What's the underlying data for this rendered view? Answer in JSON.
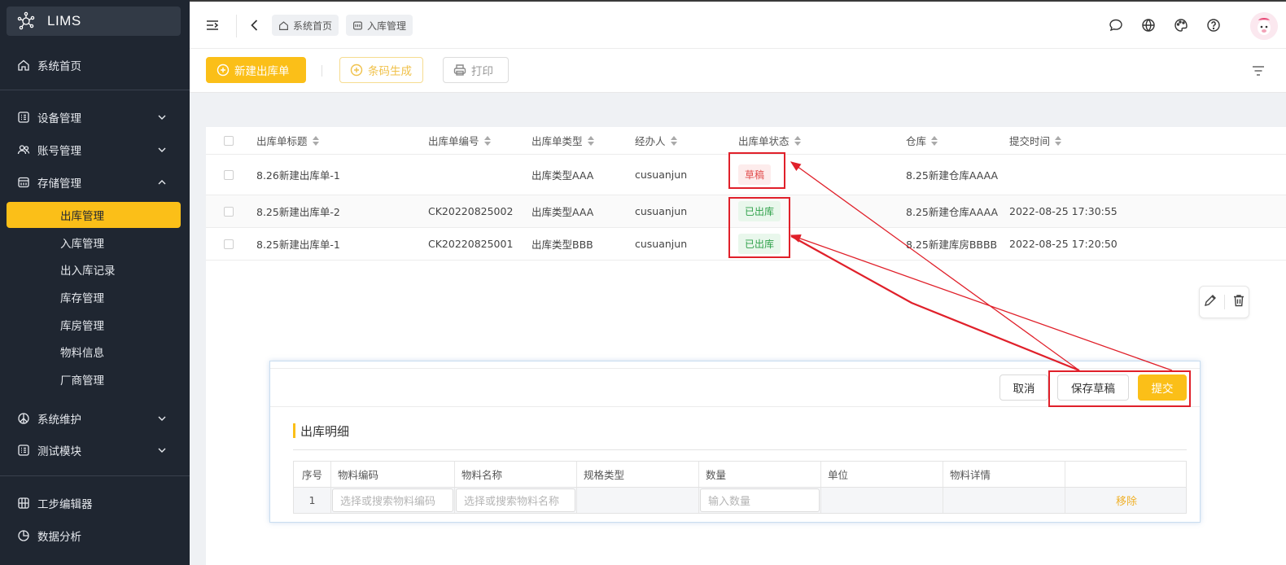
{
  "app": {
    "name": "LIMS"
  },
  "sidebar": {
    "items": [
      {
        "label": "系统首页",
        "icon": "home-icon"
      },
      {
        "label": "设备管理",
        "icon": "list-box-icon"
      },
      {
        "label": "账号管理",
        "icon": "users-icon"
      },
      {
        "label": "存储管理",
        "icon": "storage-icon"
      },
      {
        "label": "出库管理",
        "active": true
      },
      {
        "label": "入库管理"
      },
      {
        "label": "出入库记录"
      },
      {
        "label": "库存管理"
      },
      {
        "label": "库房管理"
      },
      {
        "label": "物料信息"
      },
      {
        "label": "厂商管理"
      },
      {
        "label": "系统维护",
        "icon": "peace-icon"
      },
      {
        "label": "测试模块",
        "icon": "list-box-icon"
      },
      {
        "label": "工步编辑器",
        "icon": "grid-icon"
      },
      {
        "label": "数据分析",
        "icon": "pie-chart-icon"
      }
    ]
  },
  "topbar": {
    "breadcrumbs": [
      {
        "label": "系统首页"
      },
      {
        "label": "入库管理"
      }
    ]
  },
  "toolbar": {
    "new_label": "新建出库单",
    "barcode_label": "条码生成",
    "print_label": "打印"
  },
  "table": {
    "columns": [
      "出库单标题",
      "出库单编号",
      "出库单类型",
      "经办人",
      "出库单状态",
      "仓库",
      "提交时间"
    ],
    "rows": [
      {
        "title": "8.26新建出库单-1",
        "code": "",
        "type": "出库类型AAA",
        "handler": "cusuanjun",
        "status": "草稿",
        "warehouse": "8.25新建仓库AAAA",
        "time": ""
      },
      {
        "title": "8.25新建出库单-2",
        "code": "CK20220825002",
        "type": "出库类型AAA",
        "handler": "cusuanjun",
        "status": "已出库",
        "warehouse": "8.25新建仓库AAAA",
        "time": "2022-08-25 17:30:55"
      },
      {
        "title": "8.25新建出库单-1",
        "code": "CK20220825001",
        "type": "出库类型BBB",
        "handler": "cusuanjun",
        "status": "已出库",
        "warehouse": "8.25新建库房BBBB",
        "time": "2022-08-25 17:20:50"
      }
    ]
  },
  "panel": {
    "cancel_label": "取消",
    "save_draft_label": "保存草稿",
    "submit_label": "提交",
    "section_title": "出库明细",
    "columns": [
      "序号",
      "物料编码",
      "物料名称",
      "规格类型",
      "数量",
      "单位",
      "物料详情"
    ],
    "row": {
      "index": "1",
      "code_placeholder": "选择或搜索物料编码",
      "name_placeholder": "选择或搜索物料名称",
      "qty_placeholder": "输入数量",
      "remove_label": "移除"
    }
  },
  "colors": {
    "accent": "#fbbf18",
    "sidebar_bg": "#1f2631",
    "annotation": "#e0202a",
    "draft": "#e14c4c",
    "shipped": "#2fa14a"
  }
}
